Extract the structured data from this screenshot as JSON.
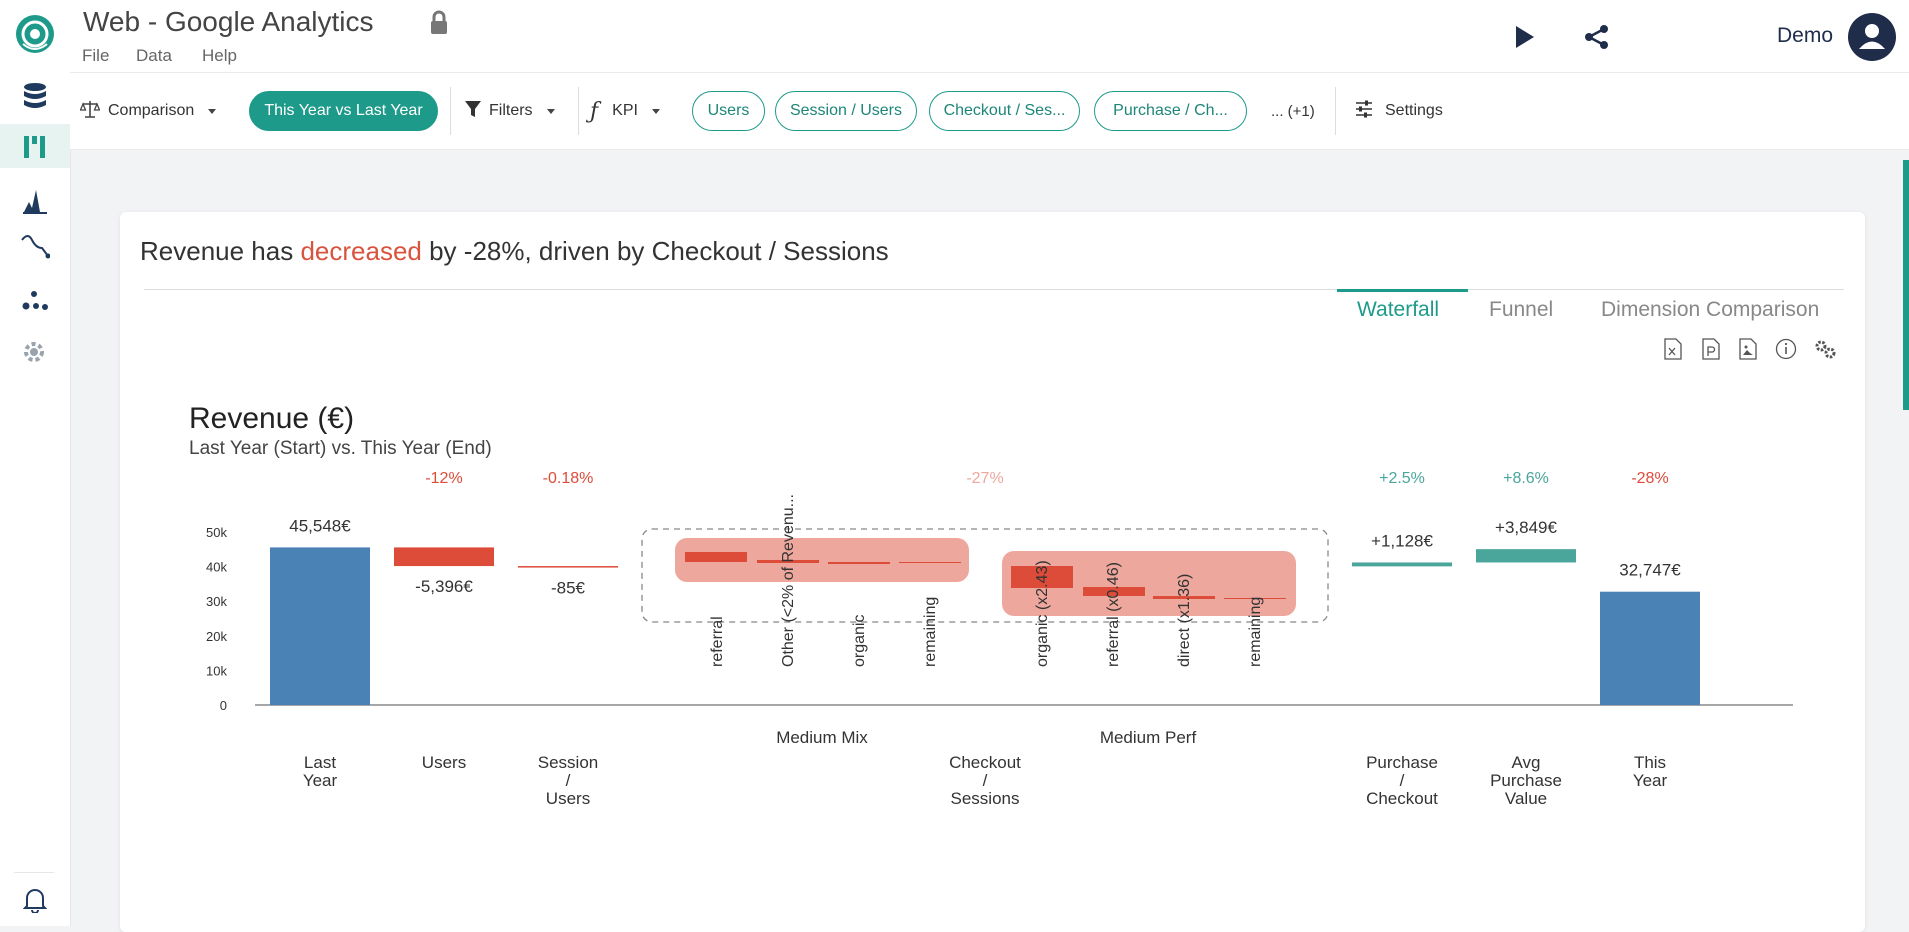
{
  "app": {
    "title": "Web - Google Analytics",
    "user": "Demo"
  },
  "menu": {
    "file": "File",
    "data": "Data",
    "help": "Help"
  },
  "sidebar": {
    "icons": [
      "database-icon",
      "waterfall-icon",
      "distribution-icon",
      "trend-icon",
      "scatter-icon",
      "settings-gear-icon"
    ],
    "active": "waterfall-icon",
    "bottom": "bell-icon"
  },
  "toolbar": {
    "comparison_label": "Comparison",
    "comparison_value": "This Year vs Last Year",
    "filters_label": "Filters",
    "kpi_label": "KPI",
    "kpis": [
      "Users",
      "Session / Users",
      "Checkout / Ses...",
      "Purchase / Ch..."
    ],
    "more": "... (+1)",
    "settings_label": "Settings"
  },
  "headline": {
    "prefix": "Revenue has ",
    "highlight": "decreased",
    "suffix": " by -28%, driven by Checkout / Sessions"
  },
  "tabs": {
    "waterfall": "Waterfall",
    "funnel": "Funnel",
    "dimension": "Dimension Comparison",
    "active": "Waterfall"
  },
  "colors": {
    "accent": "#1d9a89",
    "negative": "#dd4b39",
    "positive": "#4aa59a",
    "total": "#4a82b6",
    "group_bg": "#eea79d"
  },
  "chart_data": {
    "type": "bar",
    "title": "Revenue (€)",
    "subtitle": "Last Year (Start) vs. This Year (End)",
    "ylim": [
      0,
      50000
    ],
    "yticks": [
      "0",
      "10k",
      "20k",
      "30k",
      "40k",
      "50k"
    ],
    "steps": [
      {
        "label": [
          "Last",
          "Year"
        ],
        "kind": "total",
        "value": 45548,
        "value_label": "45,548€",
        "pct": ""
      },
      {
        "label": [
          "Users"
        ],
        "kind": "delta",
        "value": -5396,
        "value_label": "-5,396€",
        "pct": "-12%"
      },
      {
        "label": [
          "Session",
          "/",
          "Users"
        ],
        "kind": "delta",
        "value": -85,
        "value_label": "-85€",
        "pct": "-0.18%"
      },
      {
        "label": [
          "Checkout",
          "/",
          "Sessions"
        ],
        "kind": "group",
        "pct": "-27%",
        "groups": [
          {
            "name": "Medium Mix",
            "items": [
              "referral",
              "Other (<2% of Revenu...",
              "organic",
              "remaining"
            ]
          },
          {
            "name": "Medium Perf",
            "items": [
              "organic (x2.43)",
              "referral (x0.46)",
              "direct (x1.36)",
              "remaining"
            ]
          }
        ]
      },
      {
        "label": [
          "Purchase",
          "/",
          "Checkout"
        ],
        "kind": "delta",
        "value": 1128,
        "value_label": "+1,128€",
        "pct": "+2.5%"
      },
      {
        "label": [
          "Avg",
          "Purchase",
          "Value"
        ],
        "kind": "delta",
        "value": 3849,
        "value_label": "+3,849€",
        "pct": "+8.6%"
      },
      {
        "label": [
          "This",
          "Year"
        ],
        "kind": "total",
        "value": 32747,
        "value_label": "32,747€",
        "pct": "-28%"
      }
    ]
  }
}
